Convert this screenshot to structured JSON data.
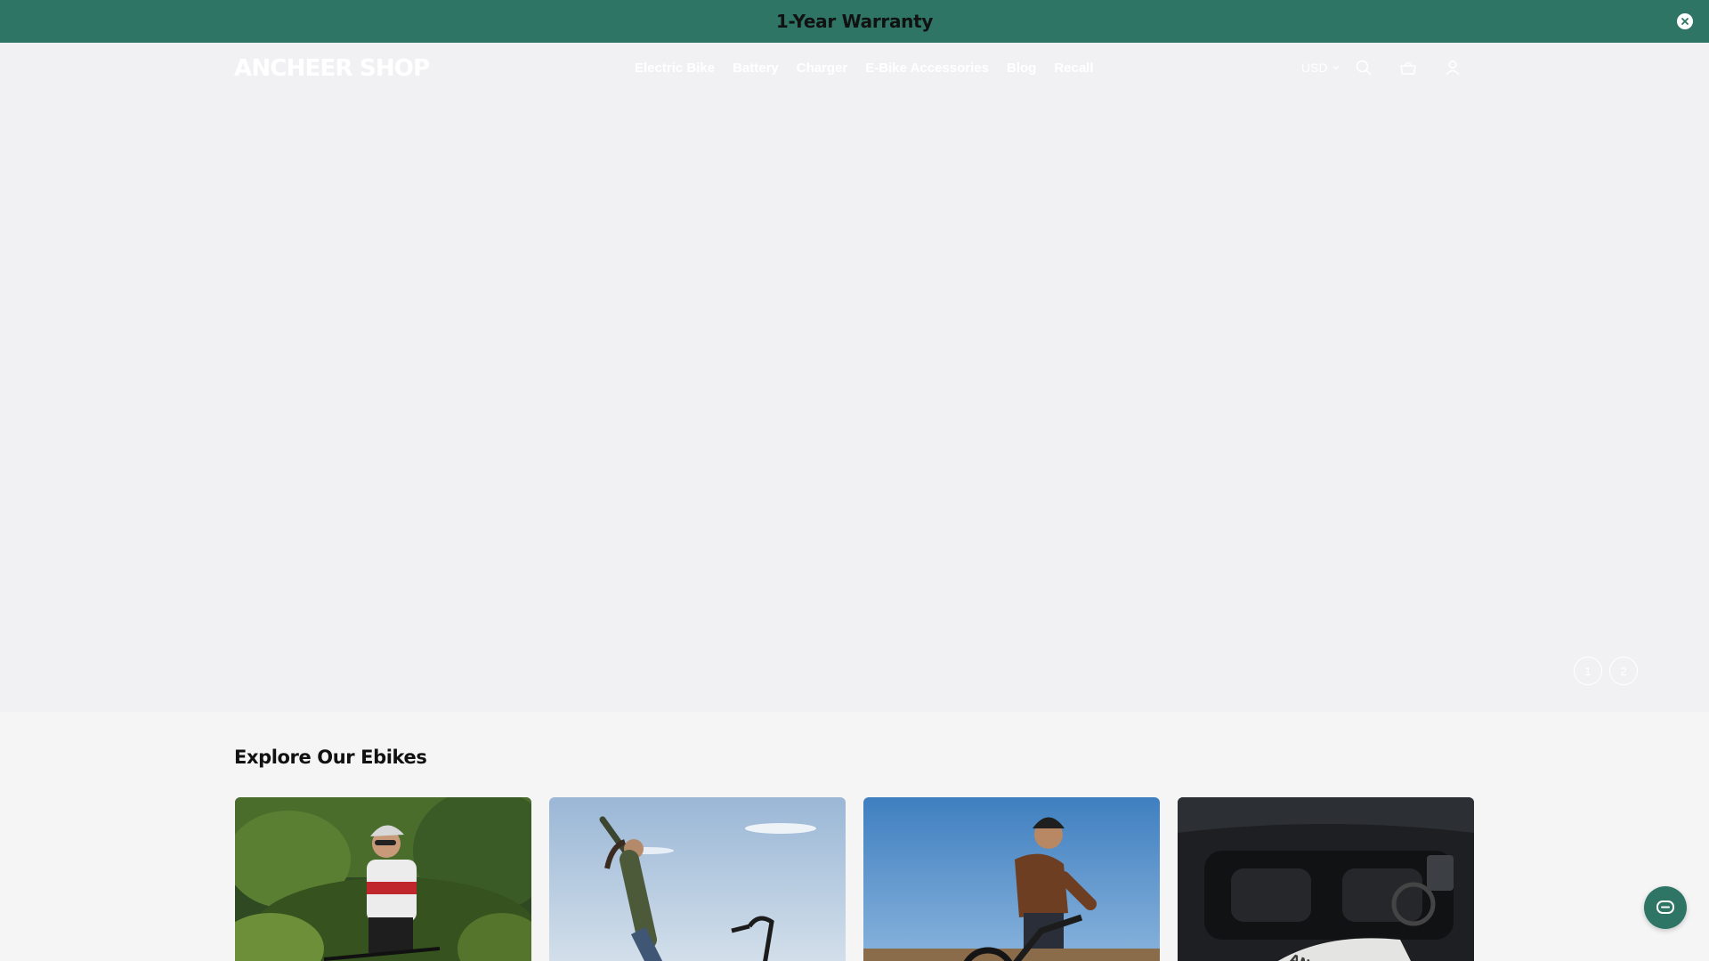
{
  "announcement": {
    "text": "1-Year Warranty",
    "background": "#2e7565"
  },
  "header": {
    "logo": "ANCHEER SHOP",
    "nav": [
      {
        "label": "Electric Bike"
      },
      {
        "label": "Battery"
      },
      {
        "label": "Charger"
      },
      {
        "label": "E-Bike Accessories"
      },
      {
        "label": "Blog"
      },
      {
        "label": "Recall"
      }
    ],
    "currency": "USD",
    "icons": [
      "search-icon",
      "cart-icon",
      "account-icon"
    ]
  },
  "hero": {
    "slides": [
      {
        "label": "1"
      },
      {
        "label": "2"
      }
    ]
  },
  "explore": {
    "title": "Explore Our Ebikes",
    "cards": [
      {
        "image": "mountain-cyclist-photo"
      },
      {
        "image": "woman-with-ebike-photo"
      },
      {
        "image": "man-riding-ebike-photo"
      },
      {
        "image": "ebike-in-car-trunk-photo"
      }
    ]
  },
  "chat": {
    "icon": "chat-icon",
    "color": "#2e7565"
  }
}
